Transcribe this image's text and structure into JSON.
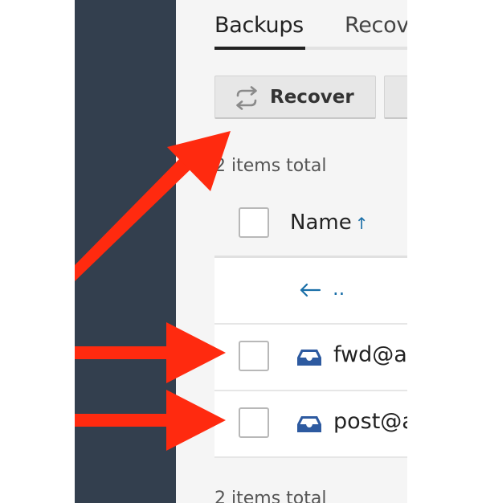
{
  "tabs": [
    {
      "label": "Backups",
      "active": true
    },
    {
      "label": "Recov",
      "active": false
    }
  ],
  "toolbar": {
    "recover_label": "Recover"
  },
  "list": {
    "total_top": "2 items total",
    "total_bottom": "2 items total",
    "header": {
      "name_label": "Name",
      "sort": "ascending"
    },
    "parent_label": "..",
    "rows": [
      {
        "name": "fwd@ar",
        "icon": "mailbox-icon"
      },
      {
        "name": "post@a",
        "icon": "mailbox-icon"
      }
    ]
  },
  "colors": {
    "sidebar": "#333f4e",
    "accent": "#1a6fa8",
    "annotation": "#ff2a0f",
    "mailbox_icon": "#2d5aa0"
  }
}
